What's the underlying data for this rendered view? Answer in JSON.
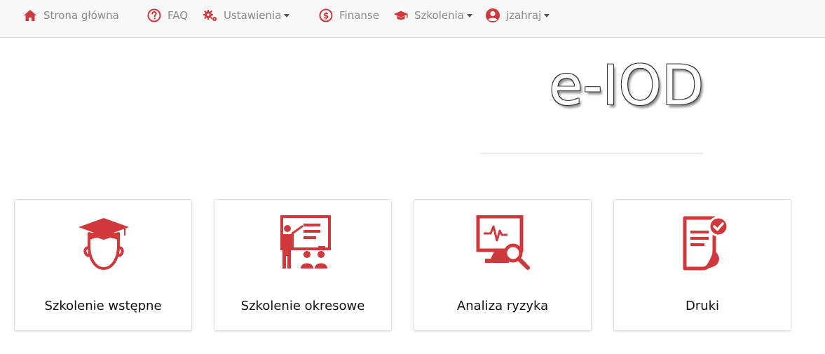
{
  "colors": {
    "accent": "#d0393b",
    "nav_text": "#8a8a8a",
    "navbar_bg": "#f8f8f8"
  },
  "navbar": {
    "items": [
      {
        "label": "Strona główna",
        "icon": "home-icon"
      },
      {
        "label": "FAQ",
        "icon": "question-circle-icon"
      },
      {
        "label": "Ustawienia",
        "icon": "gears-icon",
        "dropdown": true
      },
      {
        "label": "Finanse",
        "icon": "dollar-circle-icon"
      },
      {
        "label": "Szkolenia",
        "icon": "graduation-cap-icon",
        "dropdown": true
      },
      {
        "label": "jzahraj",
        "icon": "user-circle-icon",
        "dropdown": true
      }
    ]
  },
  "brand": {
    "logo_text": "e-IOD"
  },
  "cards": [
    {
      "label": "Szkolenie wstępne",
      "icon": "student-graduation-icon"
    },
    {
      "label": "Szkolenie okresowe",
      "icon": "presentation-teacher-icon"
    },
    {
      "label": "Analiza ryzyka",
      "icon": "monitor-analysis-icon"
    },
    {
      "label": "Druki",
      "icon": "document-check-icon"
    }
  ]
}
